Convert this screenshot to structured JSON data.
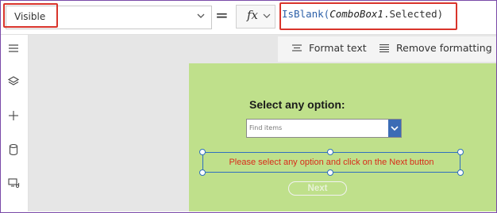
{
  "formula_bar": {
    "property_value": "Visible",
    "equals": "=",
    "fx_label": "fx",
    "formula_fn": "IsBlank(",
    "formula_arg": "ComboBox1",
    "formula_rest": ".Selected)"
  },
  "toolbar": {
    "format_text_label": "Format text",
    "remove_formatting_label": "Remove formatting"
  },
  "rail": {
    "items": [
      "menu-icon",
      "layers-icon",
      "add-icon",
      "database-icon",
      "media-icon"
    ]
  },
  "screen": {
    "question_label": "Select any option:",
    "combo_placeholder": "Find items",
    "message_text": "Please select any option and click on the Next button",
    "next_label": "Next"
  },
  "colors": {
    "screen_bg": "#bfe08b",
    "highlight_red": "#d9342b",
    "selection_blue": "#2f6fc0",
    "message_red": "#d92b1a",
    "combo_button": "#3b6cb5"
  }
}
